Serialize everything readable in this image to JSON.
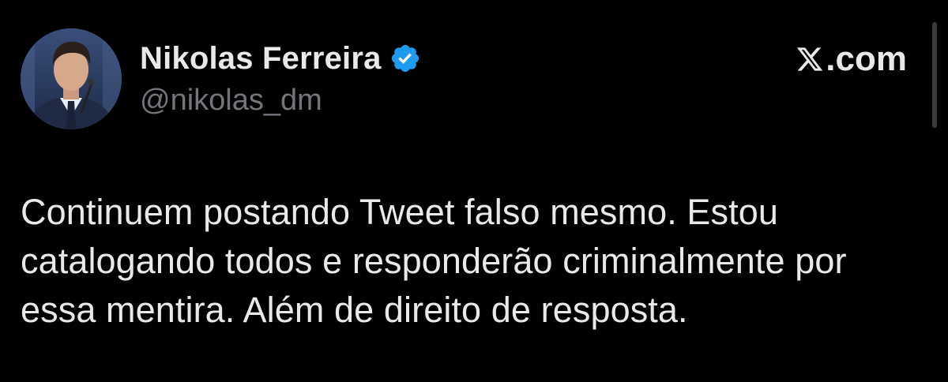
{
  "author": {
    "display_name": "Nikolas Ferreira",
    "handle": "@nikolas_dm",
    "verified_icon": "verified-badge-icon",
    "avatar_icon": "profile-photo"
  },
  "brand": {
    "logo_icon": "x-logo-icon",
    "suffix": ".com"
  },
  "tweet": {
    "lines": [
      "Continuem postando Tweet falso mesmo. Estou",
      "catalogando todos e responderão criminalmente por",
      "essa mentira. Além de direito de resposta."
    ]
  },
  "colors": {
    "background": "#000000",
    "text_primary": "#e7e9ea",
    "text_secondary": "#71767b",
    "verified_blue": "#1d9bf0"
  }
}
